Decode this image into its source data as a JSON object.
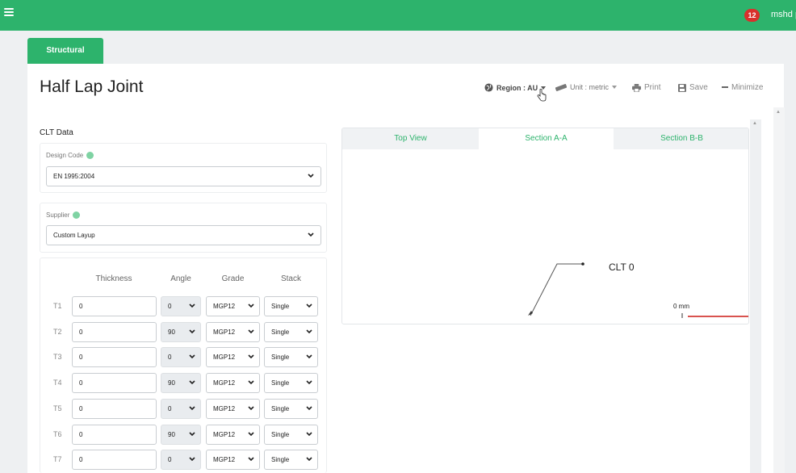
{
  "topbar": {
    "notification_count": "12",
    "user_name": "mshd p",
    "brand_color": "#2db36c"
  },
  "tabs": {
    "structural": "Structural"
  },
  "page": {
    "title": "Half Lap Joint"
  },
  "toolbar": {
    "region": "Region : AU",
    "unit": "Unit : metric",
    "print": "Print",
    "save": "Save",
    "minimize": "Minimize"
  },
  "clt": {
    "section_label": "CLT Data",
    "design_code_label": "Design Code",
    "design_code_value": "EN 1995:2004",
    "supplier_label": "Supplier",
    "supplier_value": "Custom Layup"
  },
  "layers": {
    "headers": {
      "thickness": "Thickness",
      "angle": "Angle",
      "grade": "Grade",
      "stack": "Stack"
    },
    "rows": [
      {
        "label": "T1",
        "thickness": "0",
        "angle": "0",
        "grade": "MGP12",
        "stack": "Single"
      },
      {
        "label": "T2",
        "thickness": "0",
        "angle": "90",
        "grade": "MGP12",
        "stack": "Single"
      },
      {
        "label": "T3",
        "thickness": "0",
        "angle": "0",
        "grade": "MGP12",
        "stack": "Single"
      },
      {
        "label": "T4",
        "thickness": "0",
        "angle": "90",
        "grade": "MGP12",
        "stack": "Single"
      },
      {
        "label": "T5",
        "thickness": "0",
        "angle": "0",
        "grade": "MGP12",
        "stack": "Single"
      },
      {
        "label": "T6",
        "thickness": "0",
        "angle": "90",
        "grade": "MGP12",
        "stack": "Single"
      },
      {
        "label": "T7",
        "thickness": "0",
        "angle": "0",
        "grade": "MGP12",
        "stack": "Single"
      }
    ]
  },
  "view": {
    "tabs": [
      "Top View",
      "Section A-A",
      "Section B-B"
    ],
    "active_tab": "Section A-A",
    "callout_label": "CLT 0",
    "dimension_label": "0 mm"
  }
}
